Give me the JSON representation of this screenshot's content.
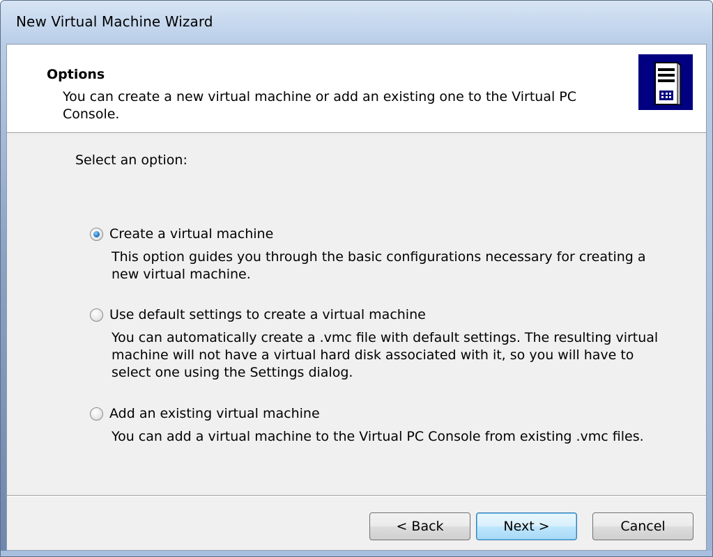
{
  "window": {
    "title": "New Virtual Machine Wizard"
  },
  "header": {
    "title": "Options",
    "description": "You can create a new virtual machine or add an existing one to the Virtual PC Console.",
    "icon": "server-tower-icon"
  },
  "body": {
    "select_label": "Select an option:",
    "options": [
      {
        "label": "Create a virtual machine",
        "description": "This option guides you through the basic configurations necessary for creating a new virtual machine.",
        "checked": true
      },
      {
        "label": "Use default settings to create a virtual machine",
        "description": "You can automatically create a .vmc file with default settings. The resulting virtual machine will not have a virtual hard disk associated with it, so you will have to select one using the Settings dialog.",
        "checked": false
      },
      {
        "label": "Add an existing virtual machine",
        "description": "You can add a virtual machine to the Virtual PC Console from existing .vmc files.",
        "checked": false
      }
    ]
  },
  "buttons": {
    "back": "< Back",
    "next": "Next >",
    "cancel": "Cancel"
  },
  "colors": {
    "header_icon_bg": "#000080",
    "default_button_border": "#3c7fb1"
  }
}
